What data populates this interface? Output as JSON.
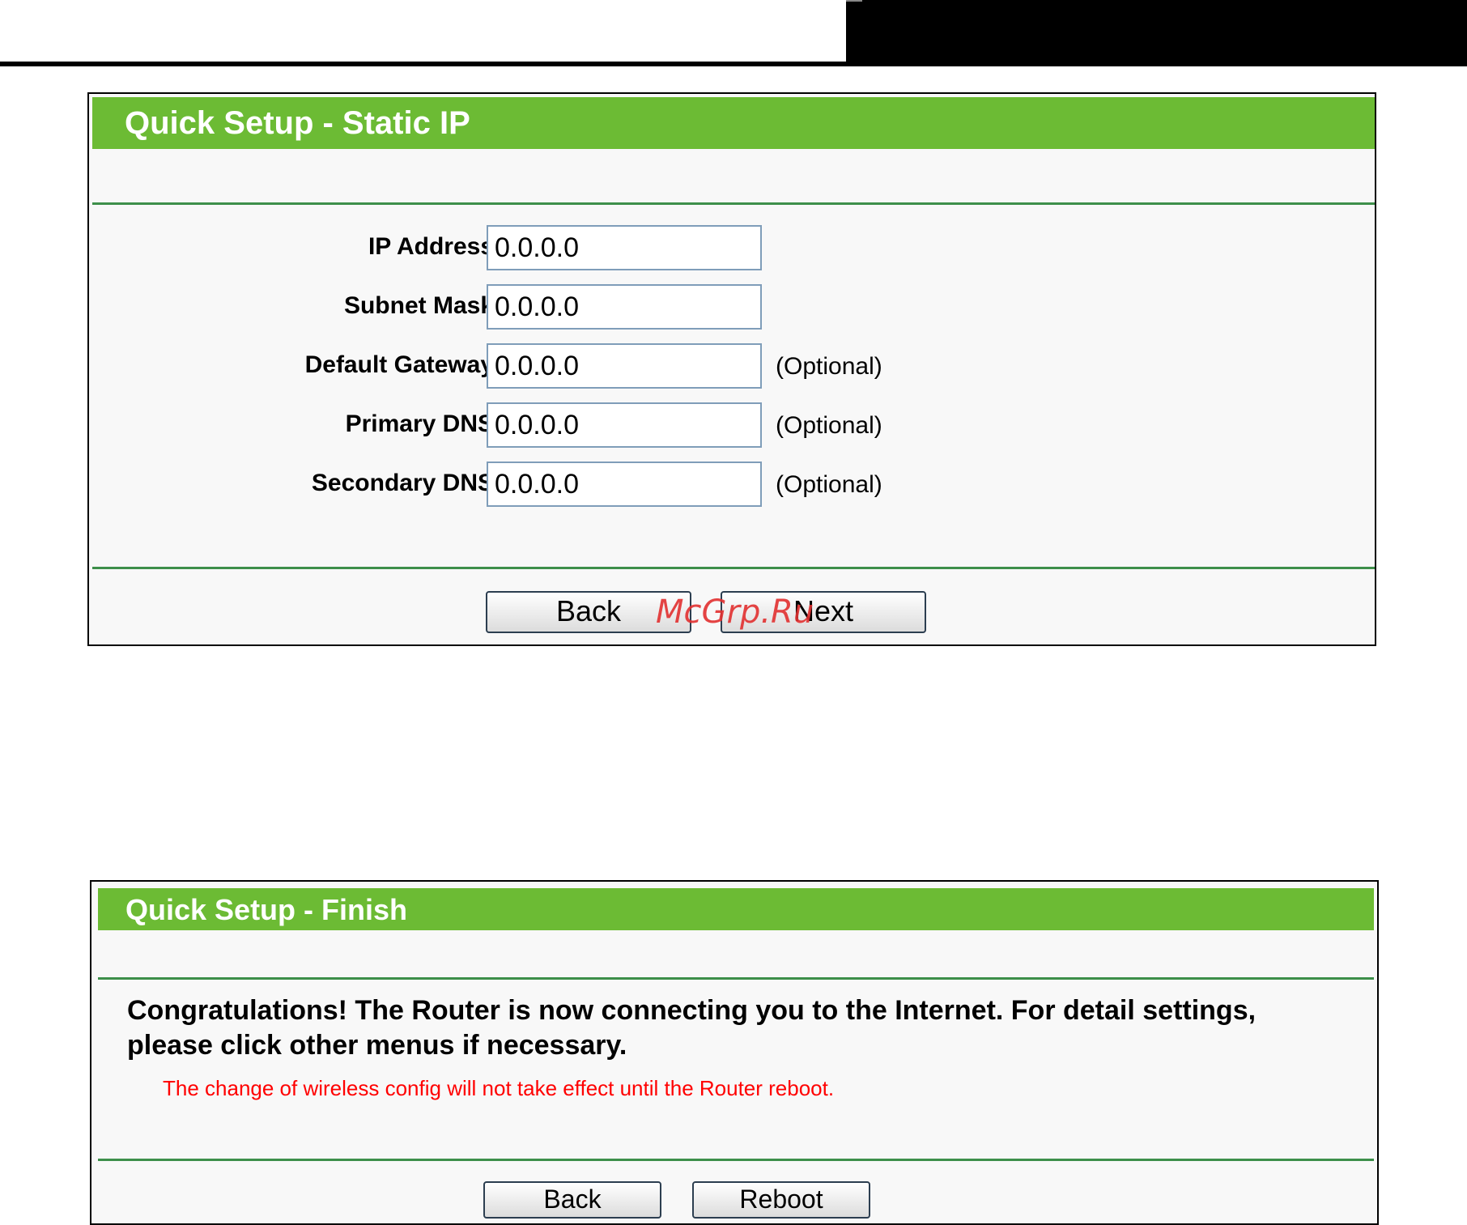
{
  "static_ip": {
    "title": "Quick Setup - Static IP",
    "fields": [
      {
        "label": "IP Address:",
        "value": "0.0.0.0",
        "note": ""
      },
      {
        "label": "Subnet Mask:",
        "value": "0.0.0.0",
        "note": ""
      },
      {
        "label": "Default Gateway:",
        "value": "0.0.0.0",
        "note": "(Optional)"
      },
      {
        "label": "Primary DNS:",
        "value": "0.0.0.0",
        "note": "(Optional)"
      },
      {
        "label": "Secondary DNS:",
        "value": "0.0.0.0",
        "note": "(Optional)"
      }
    ],
    "back_label": "Back",
    "next_label": "Next"
  },
  "watermark": "McGrp.Ru",
  "finish": {
    "title": "Quick Setup - Finish",
    "message": "Congratulations! The Router is now connecting you to the Internet. For detail settings, please click other menus if necessary.",
    "warning": "The change of wireless config will not take effect until the Router reboot.",
    "back_label": "Back",
    "reboot_label": "Reboot"
  },
  "colors": {
    "header_green": "#6cbb34",
    "divider_green": "#3d8f4a",
    "warning_red": "#ff0000"
  }
}
